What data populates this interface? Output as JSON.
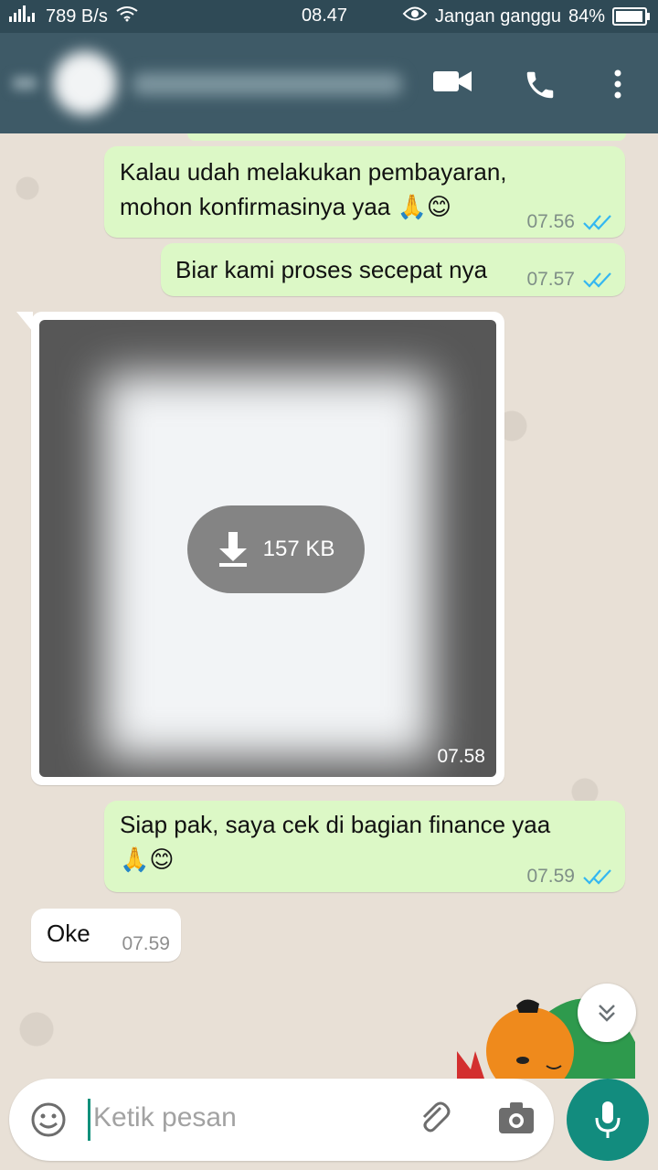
{
  "status_bar": {
    "network_rate": "789 B/s",
    "time": "08.47",
    "mode": "Jangan ganggu",
    "battery_percent": "84%",
    "battery_level": 0.84
  },
  "header": {
    "icons": {
      "back": "arrow-left-icon",
      "avatar": "contact-avatar",
      "video": "video-camera-icon",
      "call": "phone-icon",
      "menu": "more-vert-icon"
    }
  },
  "messages": [
    {
      "type": "outgoing",
      "line1": "Kalau udah melakukan pembayaran,",
      "line2": "mohon konfirmasinya yaa",
      "emoji": "🙏😊",
      "time": "07.56",
      "status": "read"
    },
    {
      "type": "outgoing",
      "text": "Biar kami proses secepat nya",
      "time": "07.57",
      "status": "read"
    },
    {
      "type": "incoming_image",
      "size": "157 KB",
      "time": "07.58"
    },
    {
      "type": "outgoing",
      "text": "Siap pak, saya cek di bagian finance yaa",
      "emoji": "🙏😊",
      "time": "07.59",
      "status": "read"
    },
    {
      "type": "incoming",
      "text": "Oke",
      "time": "07.59"
    }
  ],
  "composer": {
    "placeholder": "Ketik pesan"
  },
  "colors": {
    "header": "#3e5a67",
    "outgoing_bubble": "#dcf8c6",
    "incoming_bubble": "#ffffff",
    "accent": "#128c7e",
    "read_ticks": "#34b7f1"
  }
}
